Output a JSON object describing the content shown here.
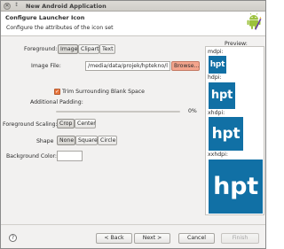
{
  "window": {
    "title": "New Android Application",
    "menu_glyph": "↕",
    "close_glyph": "✕"
  },
  "header": {
    "title": "Configure Launcher Icon",
    "description": "Configure the attributes of the icon set"
  },
  "foreground": {
    "label": "Foreground:",
    "options": [
      "Image",
      "Clipart",
      "Text"
    ],
    "selected": "Image"
  },
  "image_file": {
    "label": "Image File:",
    "value": "/media/data/projek/hptekno/l",
    "browse_label": "Browse..."
  },
  "trim": {
    "label": "Trim Surrounding Blank Space",
    "checked": true,
    "check_glyph": "✓"
  },
  "padding": {
    "label": "Additional Padding:",
    "value_text": "0%",
    "value": 0
  },
  "scaling": {
    "label": "Foreground Scaling:",
    "options": [
      "Crop",
      "Center"
    ],
    "selected": "Crop"
  },
  "shape": {
    "label": "Shape",
    "options": [
      "None",
      "Square",
      "Circle"
    ],
    "selected": "None"
  },
  "background_color": {
    "label": "Background Color:",
    "value": "#ffffff"
  },
  "preview": {
    "label": "Preview:",
    "tile_color": "#1170a5",
    "icons": [
      {
        "density": "mdpi:",
        "text": "hpt"
      },
      {
        "density": "hdpi:",
        "text": "hpt"
      },
      {
        "density": "xhdpi:",
        "text": "hpt"
      },
      {
        "density": "xxhdpi:",
        "text": "hpt"
      }
    ]
  },
  "footer": {
    "help_glyph": "?",
    "back_label": "< Back",
    "next_label": "Next >",
    "cancel_label": "Cancel",
    "finish_label": "Finish"
  }
}
